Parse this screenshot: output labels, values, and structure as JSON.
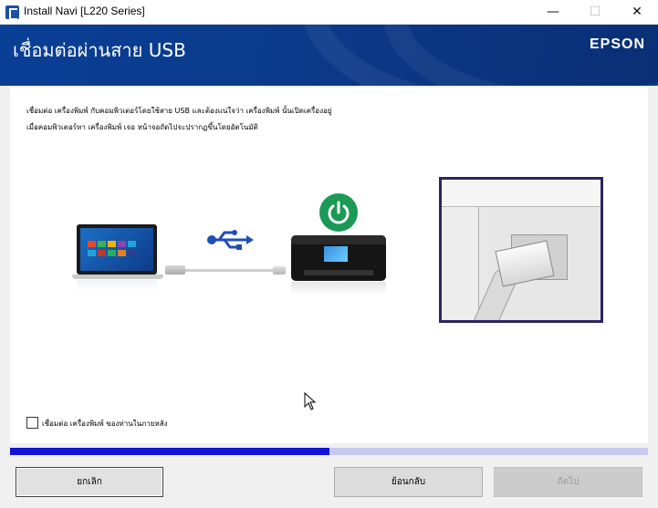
{
  "window": {
    "title": "Install Navi [L220 Series]",
    "controls": {
      "minimize": "—",
      "maximize": "☐",
      "close": "✕"
    }
  },
  "header": {
    "title": "เชื่อมต่อผ่านสาย USB",
    "brand": "EPSON"
  },
  "content": {
    "description_line1": "เชื่อมต่อ เครื่องพิมพ์ กับคอมพิวเตอร์โดยใช้สาย USB และต้องแน่ใจว่า เครื่องพิมพ์ นั้นเปิดเครื่องอยู่",
    "description_line2": "เมื่อคอมพิวเตอร์หา เครื่องพิมพ์ เจอ หน้าจอถัดไปจะปรากฏขึ้นโดยอัตโนมัติ"
  },
  "options": {
    "connect_later_label": "เชื่อมต่อ เครื่องพิมพ์ ของท่านในภายหลัง",
    "connect_later_checked": false
  },
  "progress": {
    "value_percent": 50
  },
  "buttons": {
    "cancel": "ยกเลิก",
    "back": "ย้อนกลับ",
    "next": "ถัดไป"
  },
  "icons": {
    "app": "epson-app-icon",
    "usb": "usb-symbol-icon",
    "power": "power-icon",
    "cursor": "mouse-pointer-icon"
  },
  "colors": {
    "header_blue": "#0a3f96",
    "power_green": "#1a9a55",
    "progress_fill": "#1515d8",
    "progress_track": "#c9c9f0",
    "photo_border": "#2e2462"
  }
}
